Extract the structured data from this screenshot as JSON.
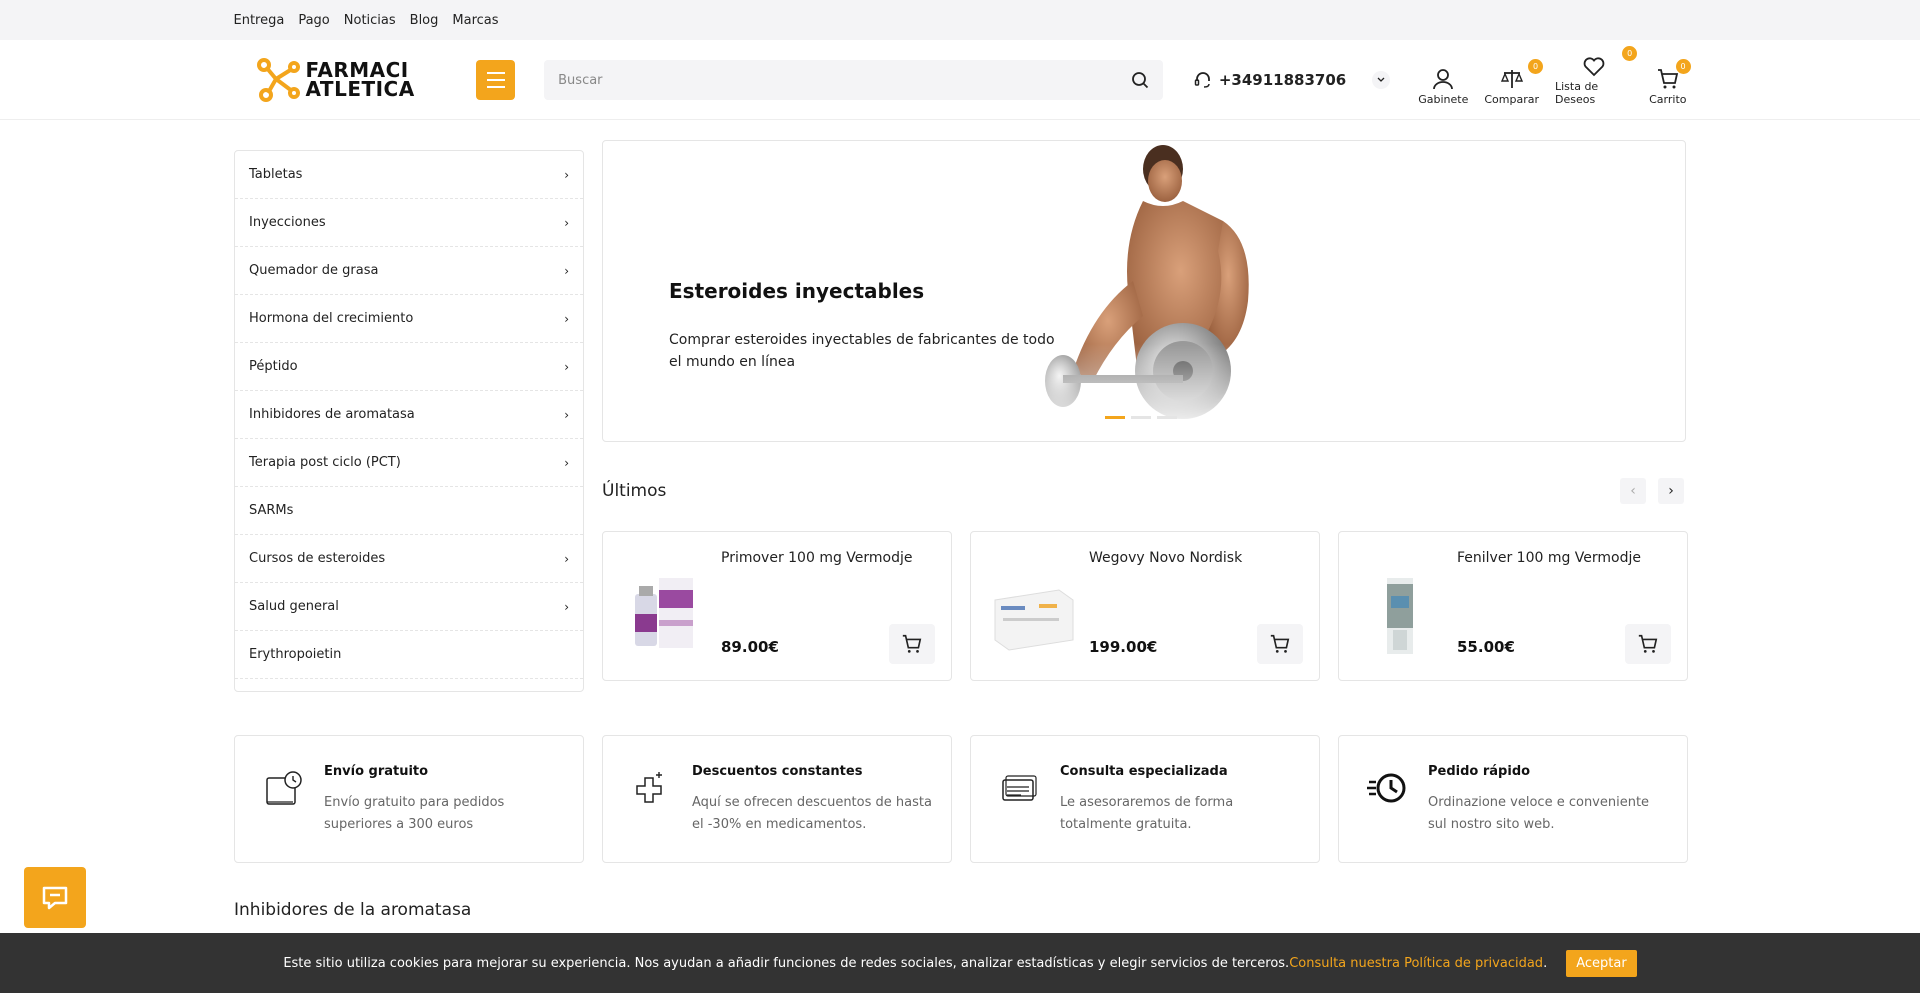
{
  "topnav": [
    "Entrega",
    "Pago",
    "Noticias",
    "Blog",
    "Marcas"
  ],
  "logo": {
    "line1": "FARMACI",
    "line2": "ATLETICA"
  },
  "search": {
    "placeholder": "Buscar"
  },
  "phone": "+34911883706",
  "header_icons": {
    "cabinet": {
      "label": "Gabinete",
      "icon": "user-icon"
    },
    "compare": {
      "label": "Comparar",
      "icon": "scales-icon",
      "badge": "0"
    },
    "wishlist": {
      "label": "Lista de Deseos",
      "icon": "heart-icon",
      "badge": "0"
    },
    "cart": {
      "label": "Carrito",
      "icon": "cart-icon",
      "badge": "0"
    }
  },
  "categories": [
    {
      "label": "Tabletas",
      "has_children": true
    },
    {
      "label": "Inyecciones",
      "has_children": true
    },
    {
      "label": "Quemador de grasa",
      "has_children": true
    },
    {
      "label": "Hormona del crecimiento",
      "has_children": true
    },
    {
      "label": "Péptido",
      "has_children": true
    },
    {
      "label": "Inhibidores de aromatasa",
      "has_children": true
    },
    {
      "label": "Terapia post ciclo (PCT)",
      "has_children": true
    },
    {
      "label": "SARMs",
      "has_children": false
    },
    {
      "label": "Cursos de esteroides",
      "has_children": true
    },
    {
      "label": "Salud general",
      "has_children": true
    },
    {
      "label": "Erythropoietin",
      "has_children": false
    }
  ],
  "hero": {
    "title": "Esteroides inyectables",
    "subtitle": "Comprar esteroides inyectables de fabricantes de todo el mundo en línea"
  },
  "latest": {
    "title": "Últimos",
    "products": [
      {
        "name": "Primover 100 mg Vermodje",
        "price": "89.00€"
      },
      {
        "name": "Wegovy Novo Nordisk",
        "price": "199.00€"
      },
      {
        "name": "Fenilver 100 mg Vermodje",
        "price": "55.00€"
      }
    ]
  },
  "features": [
    {
      "title": "Envío gratuito",
      "desc": "Envío gratuito para pedidos superiores a 300 euros",
      "icon": "shipping-icon"
    },
    {
      "title": "Descuentos constantes",
      "desc": "Aquí se ofrecen descuentos de hasta el -30% en medicamentos.",
      "icon": "plus-cross-icon"
    },
    {
      "title": "Consulta especializada",
      "desc": "Le asesoraremos de forma totalmente gratuita.",
      "icon": "cards-icon"
    },
    {
      "title": "Pedido rápido",
      "desc": "Ordinazione veloce e conveniente sul nostro sito web.",
      "icon": "fast-clock-icon"
    }
  ],
  "section2_title": "Inhibidores de la aromatasa",
  "cookie": {
    "text": "Este sitio utiliza cookies para mejorar su experiencia. Nos ayudan a añadir funciones de redes sociales, analizar estadísticas y elegir servicios de terceros. ",
    "link": "Consulta nuestra Política de privacidad",
    "dot": ".",
    "accept": "Aceptar"
  },
  "colors": {
    "accent": "#f3a51c",
    "cookie_bg": "#333333"
  }
}
